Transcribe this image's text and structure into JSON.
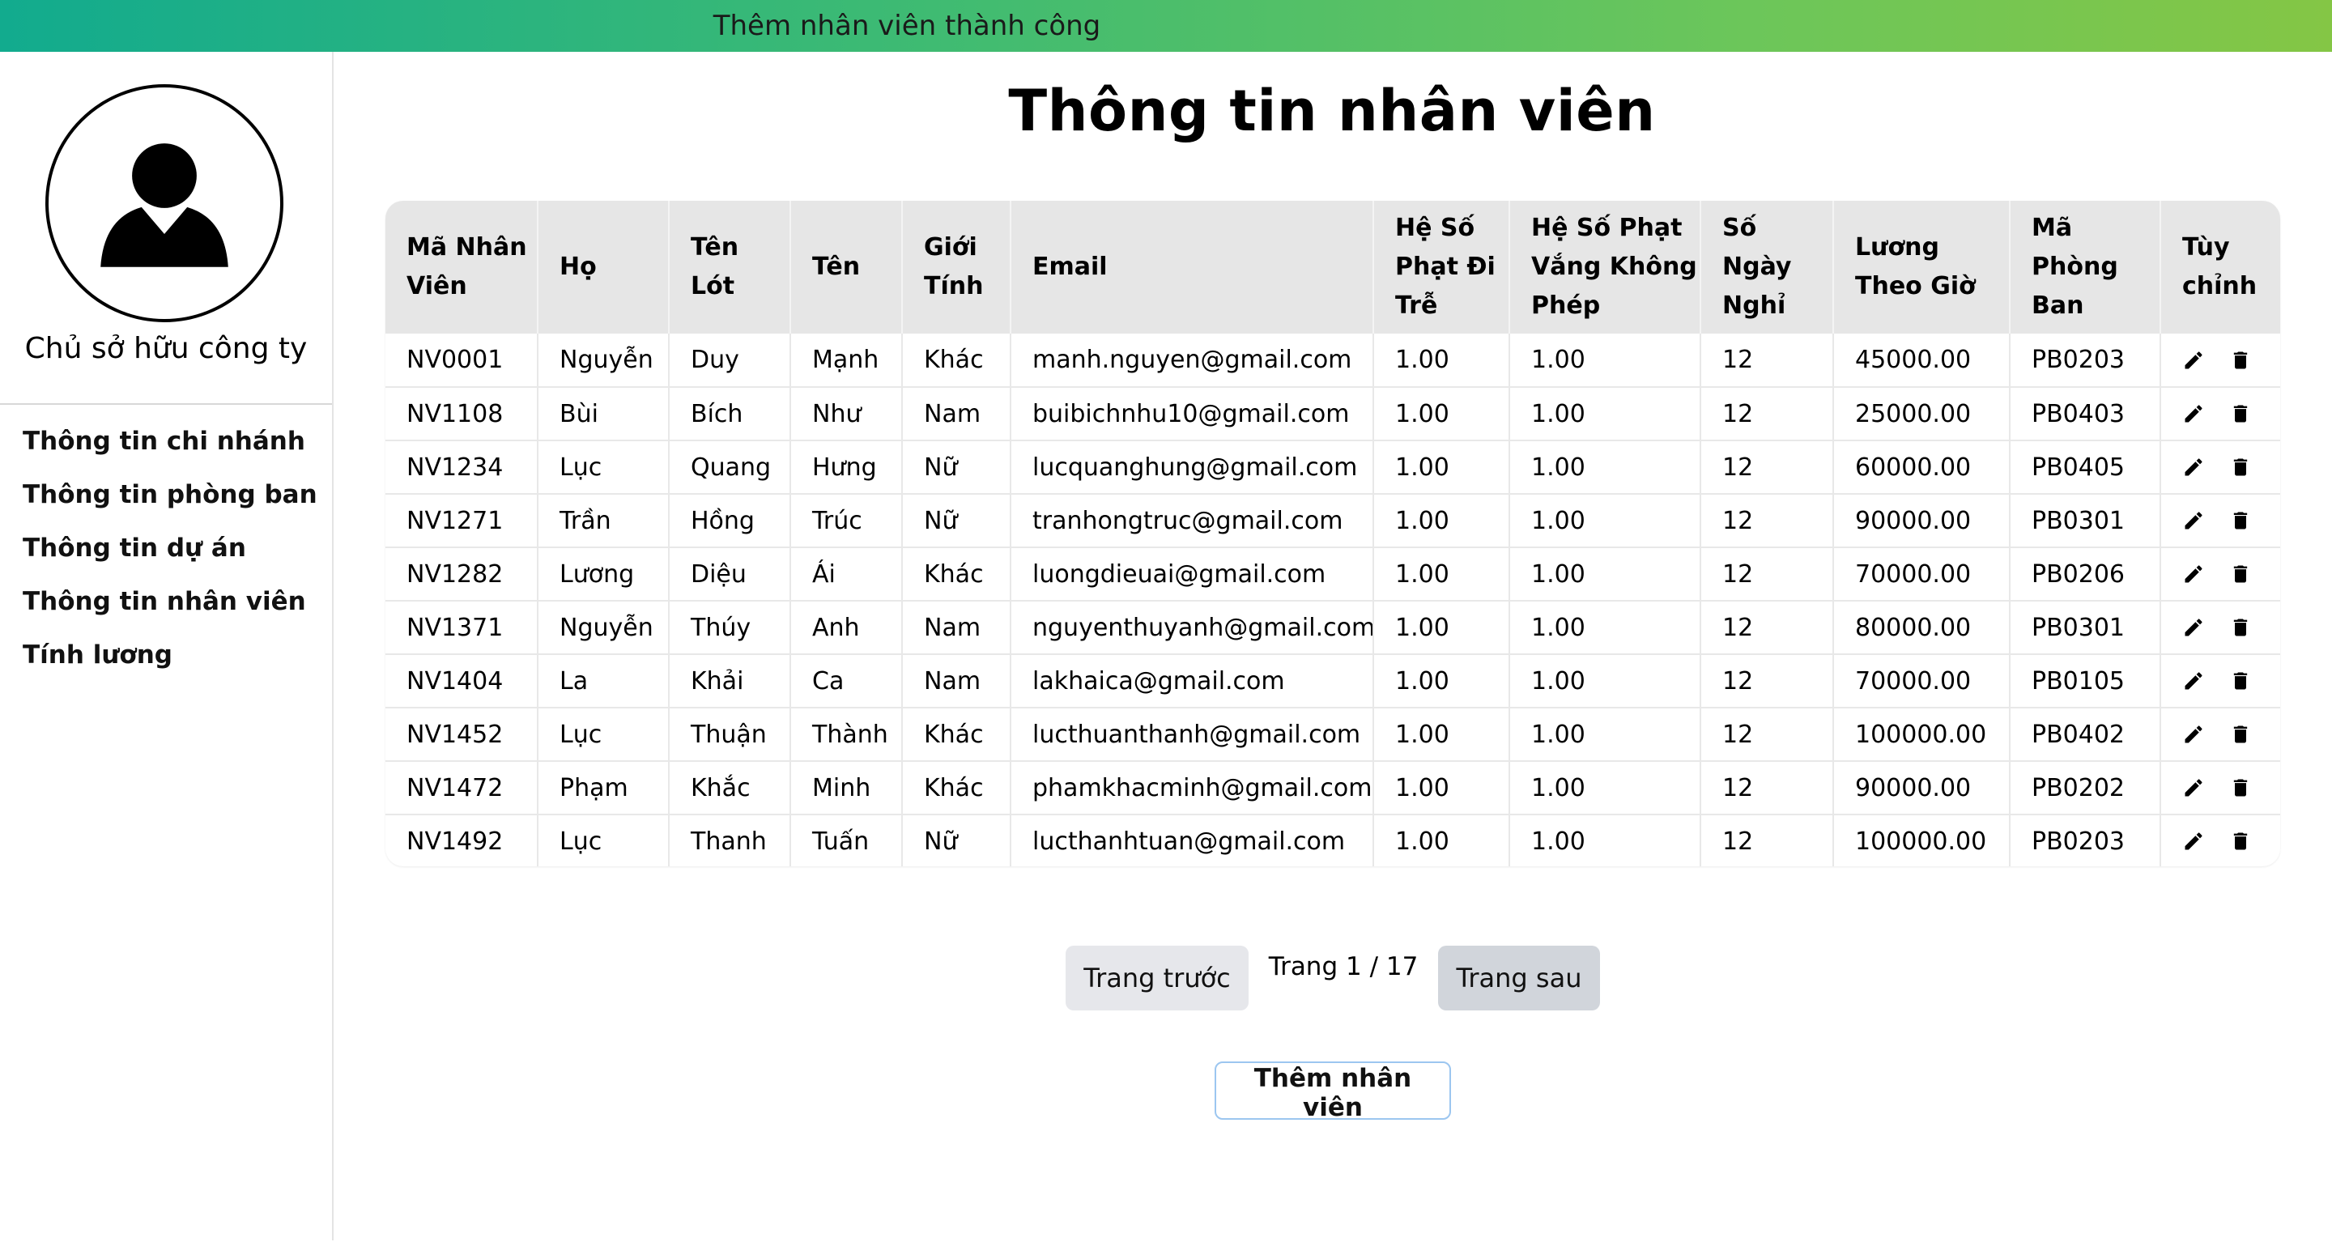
{
  "banner": {
    "message": "Thêm nhân viên thành công"
  },
  "sidebar": {
    "owner_label": "Chủ sở hữu công ty",
    "items": [
      {
        "label": "Thông tin chi nhánh"
      },
      {
        "label": "Thông tin phòng ban"
      },
      {
        "label": "Thông tin dự án"
      },
      {
        "label": "Thông tin nhân viên"
      },
      {
        "label": "Tính lương"
      }
    ]
  },
  "main": {
    "title": "Thông tin nhân viên",
    "columns": [
      "Mã Nhân Viên",
      "Họ",
      "Tên Lót",
      "Tên",
      "Giới Tính",
      "Email",
      "Hệ Số Phạt Đi Trễ",
      "Hệ Số Phạt Vắng Không Phép",
      "Số Ngày Nghỉ",
      "Lương Theo Giờ",
      "Mã Phòng Ban",
      "Tùy chỉnh"
    ],
    "rows": [
      [
        "NV0001",
        "Nguyễn",
        "Duy",
        "Mạnh",
        "Khác",
        "manh.nguyen@gmail.com",
        "1.00",
        "1.00",
        "12",
        "45000.00",
        "PB0203"
      ],
      [
        "NV1108",
        "Bùi",
        "Bích",
        "Như",
        "Nam",
        "buibichnhu10@gmail.com",
        "1.00",
        "1.00",
        "12",
        "25000.00",
        "PB0403"
      ],
      [
        "NV1234",
        "Lục",
        "Quang",
        "Hưng",
        "Nữ",
        "lucquanghung@gmail.com",
        "1.00",
        "1.00",
        "12",
        "60000.00",
        "PB0405"
      ],
      [
        "NV1271",
        "Trần",
        "Hồng",
        "Trúc",
        "Nữ",
        "tranhongtruc@gmail.com",
        "1.00",
        "1.00",
        "12",
        "90000.00",
        "PB0301"
      ],
      [
        "NV1282",
        "Lương",
        "Diệu",
        "Ái",
        "Khác",
        "luongdieuai@gmail.com",
        "1.00",
        "1.00",
        "12",
        "70000.00",
        "PB0206"
      ],
      [
        "NV1371",
        "Nguyễn",
        "Thúy",
        "Anh",
        "Nam",
        "nguyenthuyanh@gmail.com",
        "1.00",
        "1.00",
        "12",
        "80000.00",
        "PB0301"
      ],
      [
        "NV1404",
        "La",
        "Khải",
        "Ca",
        "Nam",
        "lakhaica@gmail.com",
        "1.00",
        "1.00",
        "12",
        "70000.00",
        "PB0105"
      ],
      [
        "NV1452",
        "Lục",
        "Thuận",
        "Thành",
        "Khác",
        "lucthuanthanh@gmail.com",
        "1.00",
        "1.00",
        "12",
        "100000.00",
        "PB0402"
      ],
      [
        "NV1472",
        "Phạm",
        "Khắc",
        "Minh",
        "Khác",
        "phamkhacminh@gmail.com",
        "1.00",
        "1.00",
        "12",
        "90000.00",
        "PB0202"
      ],
      [
        "NV1492",
        "Lục",
        "Thanh",
        "Tuấn",
        "Nữ",
        "lucthanhtuan@gmail.com",
        "1.00",
        "1.00",
        "12",
        "100000.00",
        "PB0203"
      ]
    ],
    "row_icons": [
      "edit-icon",
      "delete-icon"
    ]
  },
  "pagination": {
    "prev_label": "Trang trước",
    "page_info": "Trang 1 / 17",
    "next_label": "Trang sau"
  },
  "add_button_label": "Thêm nhân viên"
}
